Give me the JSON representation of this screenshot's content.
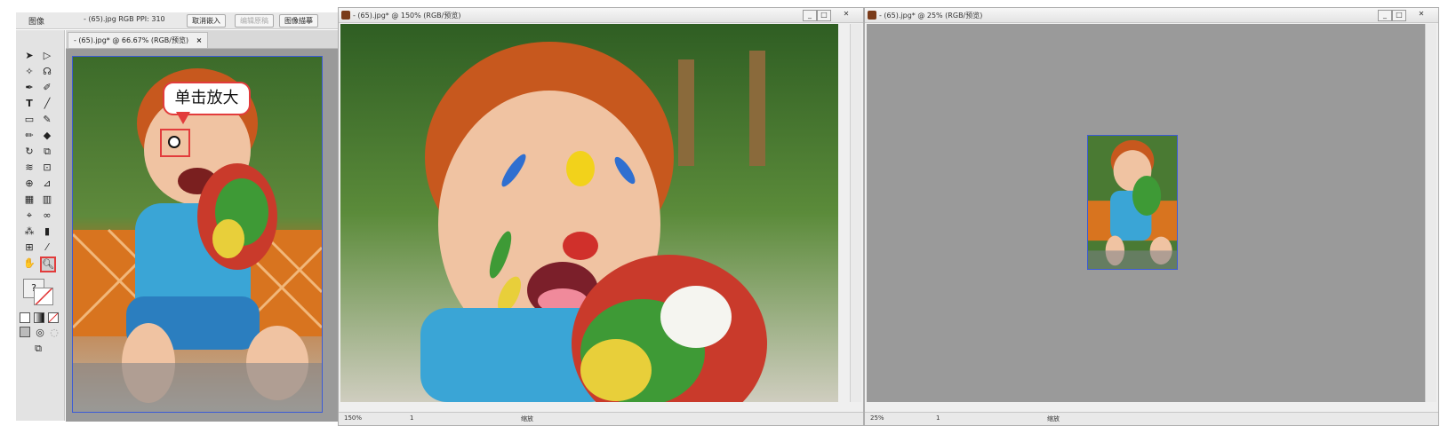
{
  "options_bar": {
    "panel_label": "图像",
    "doc_info": "- (65).jpg RGB PPI: 310",
    "btn_cancel_embed": "取消嵌入",
    "btn_edit_original": "编辑原稿",
    "btn_image_trace": "图像描摹"
  },
  "doc1": {
    "tab_title": "- (65).jpg* @ 66.67% (RGB/预览)",
    "tab_close": "×"
  },
  "callout": {
    "text": "单击放大"
  },
  "win2": {
    "title": "- (65).jpg* @ 150% (RGB/预览)",
    "zoom": "150%",
    "page": "1",
    "status": "缩放"
  },
  "win3": {
    "title": "- (65).jpg* @ 25% (RGB/预览)",
    "zoom": "25%",
    "page": "1",
    "status": "缩放"
  },
  "window_buttons": {
    "minimize": "_",
    "maximize": "□",
    "close": "✕"
  },
  "colors": {
    "highlight": "#e23c3c",
    "canvas_gray": "#9a9a9a"
  }
}
